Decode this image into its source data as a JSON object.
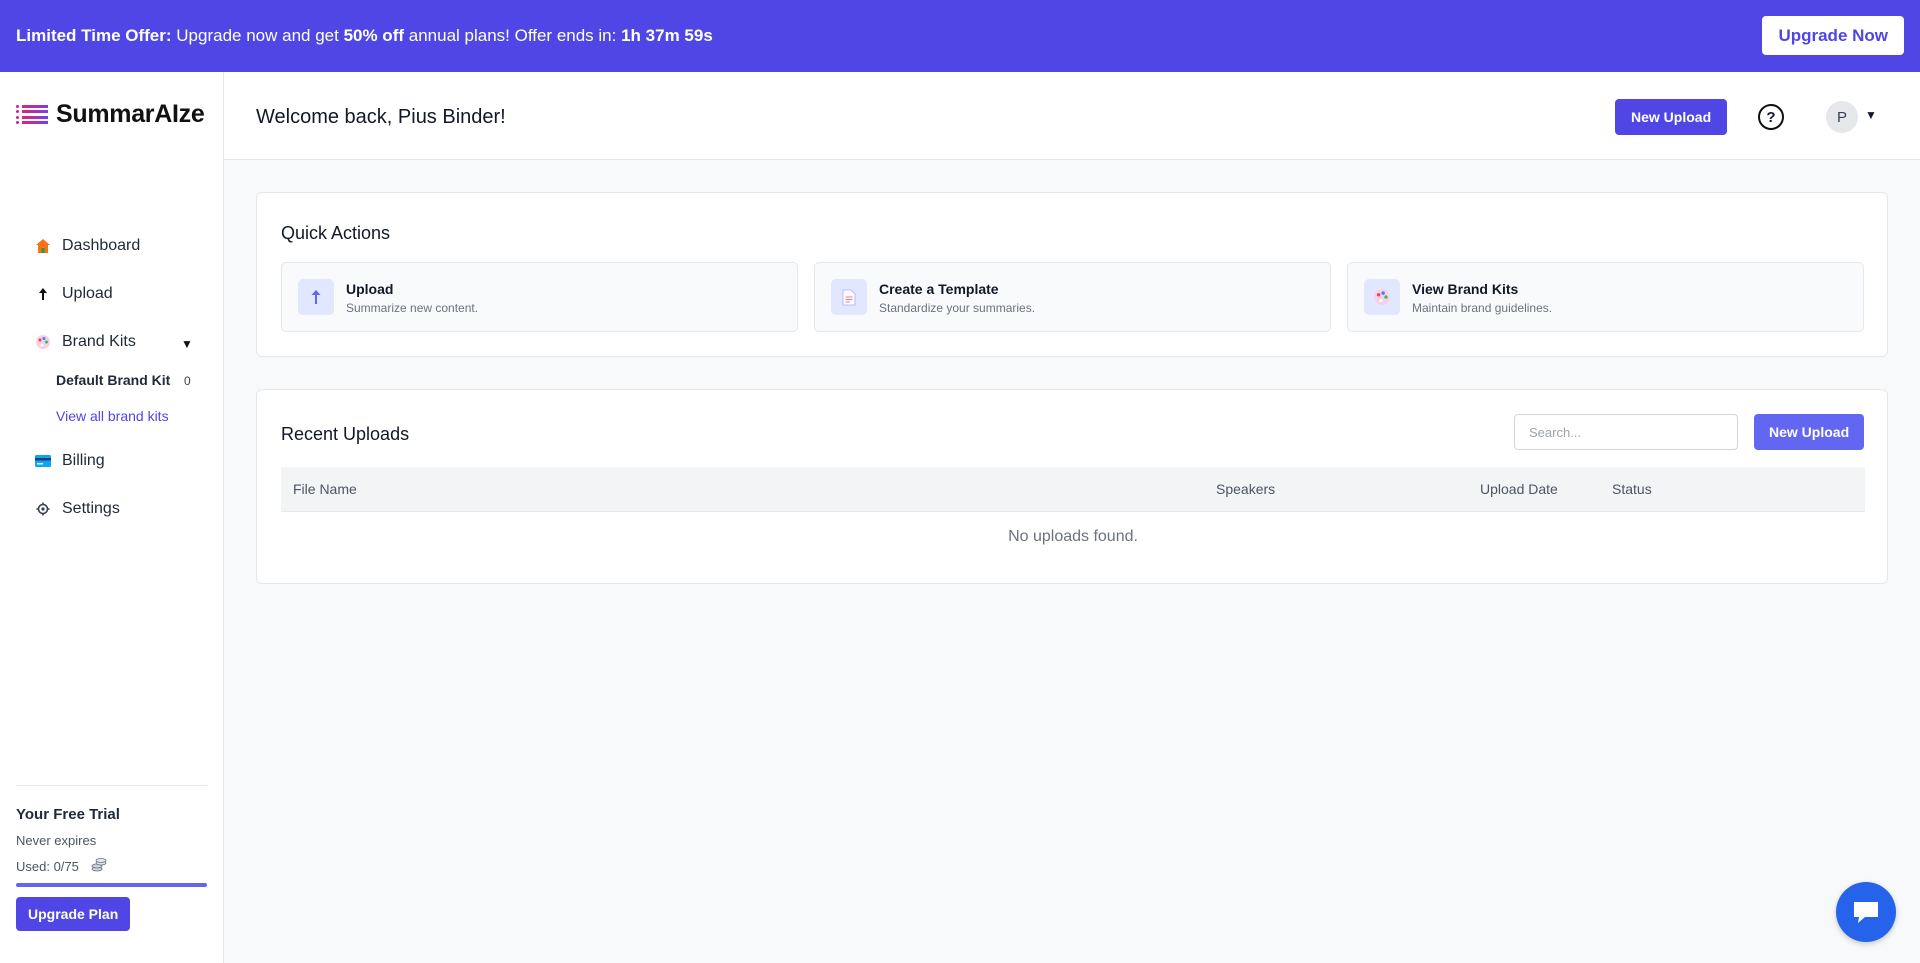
{
  "banner": {
    "lead": "Limited Time Offer:",
    "text1": " Upgrade now and get ",
    "discount": "50% off",
    "text2": " annual plans! Offer ends in: ",
    "countdown": "1h 37m 59s",
    "button_label": "Upgrade Now"
  },
  "brand": {
    "name": "SummarAIze"
  },
  "sidebar": {
    "items": [
      {
        "label": "Dashboard",
        "icon": "house-icon"
      },
      {
        "label": "Upload",
        "icon": "arrow-up-icon"
      },
      {
        "label": "Brand Kits",
        "icon": "palette-icon"
      },
      {
        "label": "Billing",
        "icon": "credit-card-icon"
      },
      {
        "label": "Settings",
        "icon": "gear-icon"
      }
    ],
    "brand_kits": {
      "default_kit": "Default Brand Kit",
      "default_count": "0",
      "view_all": "View all brand kits"
    }
  },
  "trial": {
    "title": "Your Free Trial",
    "expiry": "Never expires",
    "used": "Used: 0/75",
    "used_fraction": 0,
    "button_label": "Upgrade Plan"
  },
  "header": {
    "welcome": "Welcome back, Pius Binder!",
    "new_upload_label": "New Upload",
    "help_symbol": "?",
    "avatar_initial": "P"
  },
  "quick_actions": {
    "title": "Quick Actions",
    "items": [
      {
        "title": "Upload",
        "subtitle": "Summarize new content.",
        "icon": "upload-arrow-icon"
      },
      {
        "title": "Create a Template",
        "subtitle": "Standardize your summaries.",
        "icon": "document-icon"
      },
      {
        "title": "View Brand Kits",
        "subtitle": "Maintain brand guidelines.",
        "icon": "palette-icon"
      }
    ]
  },
  "recent_uploads": {
    "title": "Recent Uploads",
    "search_placeholder": "Search...",
    "new_upload_label": "New Upload",
    "columns": [
      "File Name",
      "Speakers",
      "Upload Date",
      "Status"
    ],
    "empty_message": "No uploads found."
  },
  "colors": {
    "accent": "#4f46e5",
    "accent_light": "#6366f1",
    "chat": "#2563eb"
  }
}
